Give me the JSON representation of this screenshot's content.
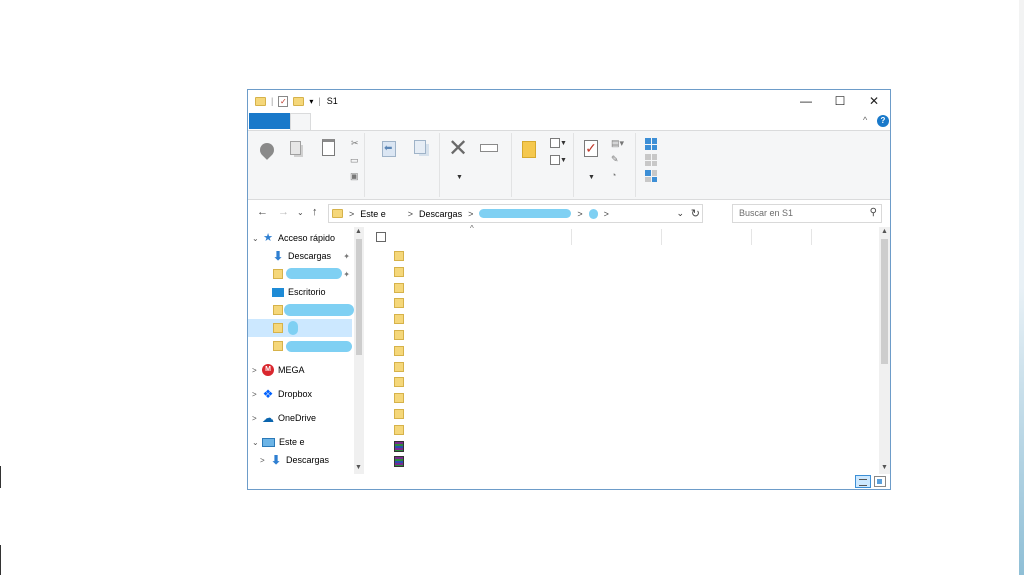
{
  "window": {
    "title": "S1",
    "minimize_glyph": "—",
    "maximize_glyph": "☐",
    "close_glyph": "✕"
  },
  "titlebar": {
    "qat_sep": "|",
    "qat_dropdown": "▾"
  },
  "ribbon": {
    "help_glyph": "?",
    "collapse_glyph": "^"
  },
  "address": {
    "segments": [
      "Este e",
      "Descargas"
    ],
    "separator": ">",
    "dropdown_glyph": "⌄",
    "refresh_glyph": "↻"
  },
  "search": {
    "placeholder": "Buscar en S1",
    "icon": "search-icon"
  },
  "nav": {
    "back": "←",
    "forward": "→",
    "recent": "⌄",
    "up": "↑"
  },
  "navpane": {
    "items": [
      {
        "label": "Acceso rápido",
        "icon": "star-icon"
      },
      {
        "label": "Descargas",
        "icon": "download-icon"
      },
      {
        "label": "",
        "icon": "folder-icon"
      },
      {
        "label": "Escritorio",
        "icon": "desktop-icon"
      },
      {
        "label": "",
        "icon": "folder-icon"
      },
      {
        "label": "",
        "icon": "folder-icon"
      },
      {
        "label": "",
        "icon": "folder-icon"
      },
      {
        "label": "MEGA",
        "icon": "mega-icon"
      },
      {
        "label": "Dropbox",
        "icon": "dropbox-icon"
      },
      {
        "label": "OneDrive",
        "icon": "onedrive-icon"
      },
      {
        "label": "Este e",
        "icon": "pc-icon"
      },
      {
        "label": "Descargas",
        "icon": "download-icon"
      }
    ],
    "expander_open": "⌄",
    "expander_closed": ">",
    "pin_glyph": "📌",
    "mega_letter": "M"
  },
  "content": {
    "sort_glyph": "^",
    "files": [
      {
        "type": "folder"
      },
      {
        "type": "folder"
      },
      {
        "type": "folder"
      },
      {
        "type": "folder"
      },
      {
        "type": "folder"
      },
      {
        "type": "folder"
      },
      {
        "type": "folder"
      },
      {
        "type": "folder"
      },
      {
        "type": "folder"
      },
      {
        "type": "folder"
      },
      {
        "type": "folder"
      },
      {
        "type": "folder"
      },
      {
        "type": "rar"
      },
      {
        "type": "rar"
      }
    ]
  },
  "colors": {
    "accent": "#1979ca",
    "selection": "#cce8ff",
    "redaction": "#7fd0f3",
    "folder": "#f5d77a"
  }
}
